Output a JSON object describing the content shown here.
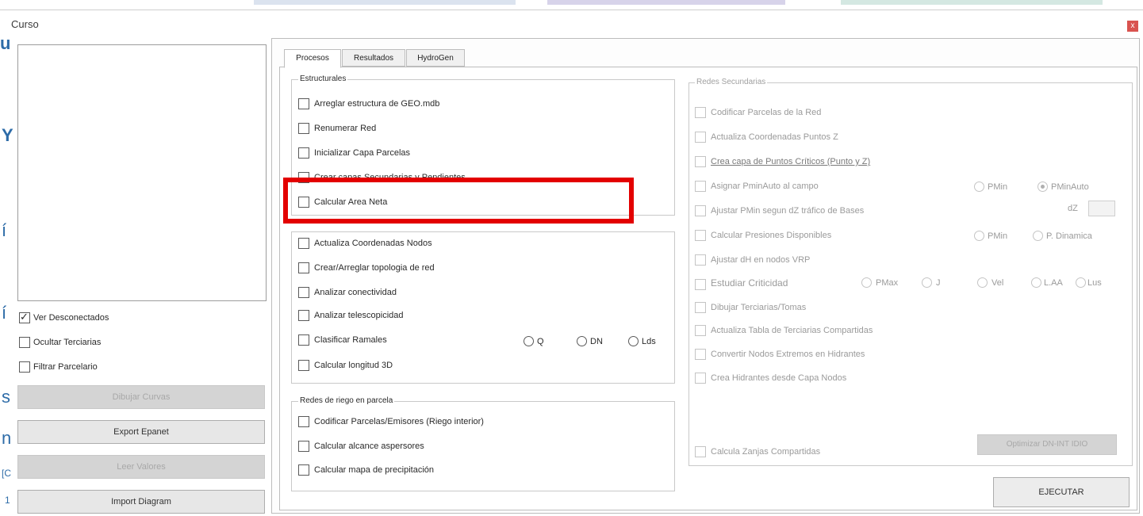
{
  "window": {
    "title": "Curso",
    "close_label": "x"
  },
  "background_fragments": [
    "u",
    "Y",
    "í",
    "í",
    "s",
    "n",
    "[C",
    "1"
  ],
  "left_panel": {
    "checkboxes": [
      {
        "label": "Ver Desconectados",
        "checked": true
      },
      {
        "label": "Ocultar Terciarias",
        "checked": false
      },
      {
        "label": "Filtrar Parcelario",
        "checked": false
      }
    ],
    "buttons": [
      {
        "label": "Dibujar Curvas",
        "enabled": false
      },
      {
        "label": "Export Epanet",
        "enabled": true
      },
      {
        "label": "Leer Valores",
        "enabled": false
      },
      {
        "label": "Import Diagram",
        "enabled": true
      }
    ]
  },
  "tabs": [
    {
      "label": "Procesos",
      "active": true
    },
    {
      "label": "Resultados",
      "active": false
    },
    {
      "label": "HydroGen",
      "active": false
    }
  ],
  "groups": {
    "estructurales": {
      "title": "Estructurales",
      "items": [
        "Arreglar estructura de GEO.mdb",
        "Renumerar Red",
        "Inicializar Capa Parcelas",
        "Crear capas Secundarias y Pendientes",
        "Calcular Area Neta"
      ]
    },
    "topologia": {
      "items": [
        "Actualiza Coordenadas Nodos",
        "Crear/Arreglar topologia de red",
        "Analizar conectividad",
        "Analizar telescopicidad",
        "Clasificar Ramales",
        "Calcular longitud 3D"
      ],
      "radios": [
        "Q",
        "DN",
        "Lds"
      ]
    },
    "riego": {
      "title": "Redes de riego en parcela",
      "items": [
        "Codificar Parcelas/Emisores (Riego interior)",
        "Calcular alcance aspersores",
        "Calcular mapa de precipitación"
      ]
    },
    "secundarias": {
      "title": "Redes Secundarias",
      "items": [
        "Codificar Parcelas de la Red",
        "Actualiza Coordenadas Puntos Z",
        "Crea capa de Puntos Críticos (Punto y Z)",
        "Asignar PminAuto al campo",
        "Ajustar PMin segun dZ tráfico de Bases",
        "Calcular Presiones Disponibles",
        "Ajustar dH en nodos VRP",
        "Estudiar Criticidad",
        "Dibujar Terciarias/Tomas",
        "Actualiza Tabla de Terciarias Compartidas",
        "Convertir Nodos Extremos en Hidrantes",
        "Crea Hidrantes desde Capa Nodos"
      ],
      "pmin_radios": [
        "PMin",
        "PMinAuto"
      ],
      "dz_label": "dZ",
      "presion_radios": [
        "PMin",
        "P. Dinamica"
      ],
      "criticidad_radios": [
        "PMax",
        "J",
        "Vel",
        "L.AA",
        "Lus"
      ],
      "zanjas_label": "Calcula Zanjas Compartidas",
      "optimizar_label": "Optimizar DN-INT IDIO"
    }
  },
  "execute_label": "EJECUTAR"
}
